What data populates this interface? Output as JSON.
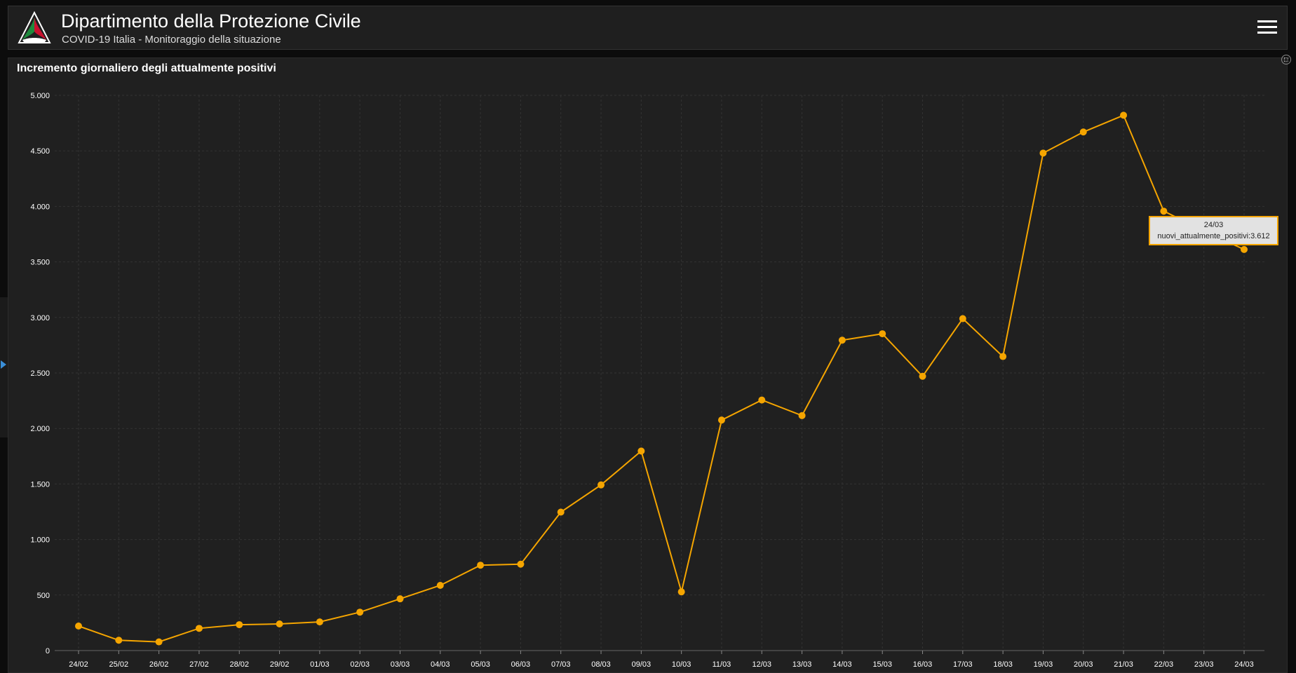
{
  "header": {
    "title": "Dipartimento della Protezione Civile",
    "subtitle": "COVID-19 Italia - Monitoraggio della situazione"
  },
  "colors": {
    "line": "#f5a500",
    "background": "#202020",
    "grid": "#333333",
    "text": "#ffffff"
  },
  "tooltip": {
    "date": "24/03",
    "label": "nuovi_attualmente_positivi:3.612"
  },
  "chart_data": {
    "type": "line",
    "title": "Incremento giornaliero degli attualmente positivi",
    "categories": [
      "24/02",
      "25/02",
      "26/02",
      "27/02",
      "28/02",
      "29/02",
      "01/03",
      "02/03",
      "03/03",
      "04/03",
      "05/03",
      "06/03",
      "07/03",
      "08/03",
      "09/03",
      "10/03",
      "11/03",
      "12/03",
      "13/03",
      "14/03",
      "15/03",
      "16/03",
      "17/03",
      "18/03",
      "19/03",
      "20/03",
      "21/03",
      "22/03",
      "23/03",
      "24/03"
    ],
    "series": [
      {
        "values": [
          221,
          93,
          78,
          200,
          233,
          240,
          258,
          346,
          466,
          587,
          769,
          778,
          1247,
          1492,
          1797,
          529,
          2076,
          2256,
          2116,
          2795,
          2853,
          2470,
          2989,
          2648,
          4480,
          4670,
          4821,
          3957,
          3780,
          3612
        ]
      }
    ],
    "yticks": [
      0,
      500,
      1000,
      1500,
      2000,
      2500,
      3000,
      3500,
      4000,
      4500,
      5000
    ],
    "ytick_labels": [
      "0",
      "500",
      "1.000",
      "1.500",
      "2.000",
      "2.500",
      "3.000",
      "3.500",
      "4.000",
      "4.500",
      "5.000"
    ],
    "ylim": [
      0,
      5000
    ],
    "grid": true,
    "legend": "none"
  }
}
